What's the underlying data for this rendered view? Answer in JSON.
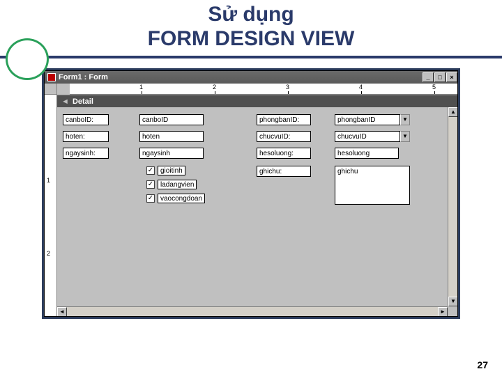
{
  "slide": {
    "title_line1": "Sử dụng",
    "title_line2": "FORM DESIGN VIEW",
    "page_number": "27"
  },
  "window": {
    "title": "Form1 : Form",
    "section_label": "Detail"
  },
  "ruler_h": [
    "1",
    "2",
    "3",
    "4",
    "5"
  ],
  "ruler_v": [
    "1",
    "2"
  ],
  "labels": {
    "canboID": "canboID:",
    "hoten": "hoten:",
    "ngaysinh": "ngaysinh:",
    "phongbanID": "phongbanID:",
    "chucvuID": "chucvuID:",
    "hesoluong": "hesoluong:",
    "ghichu": "ghichu:"
  },
  "fields": {
    "canboID": "canboID",
    "hoten": "hoten",
    "ngaysinh": "ngaysinh",
    "phongbanID": "phongbanID",
    "chucvuID": "chucvuID",
    "hesoluong": "hesoluong",
    "ghichu": "ghichu"
  },
  "checkboxes": {
    "gioitinh": "gioitinh",
    "ladangvien": "ladangvien",
    "vaocongdoan": "vaocongdoan"
  }
}
